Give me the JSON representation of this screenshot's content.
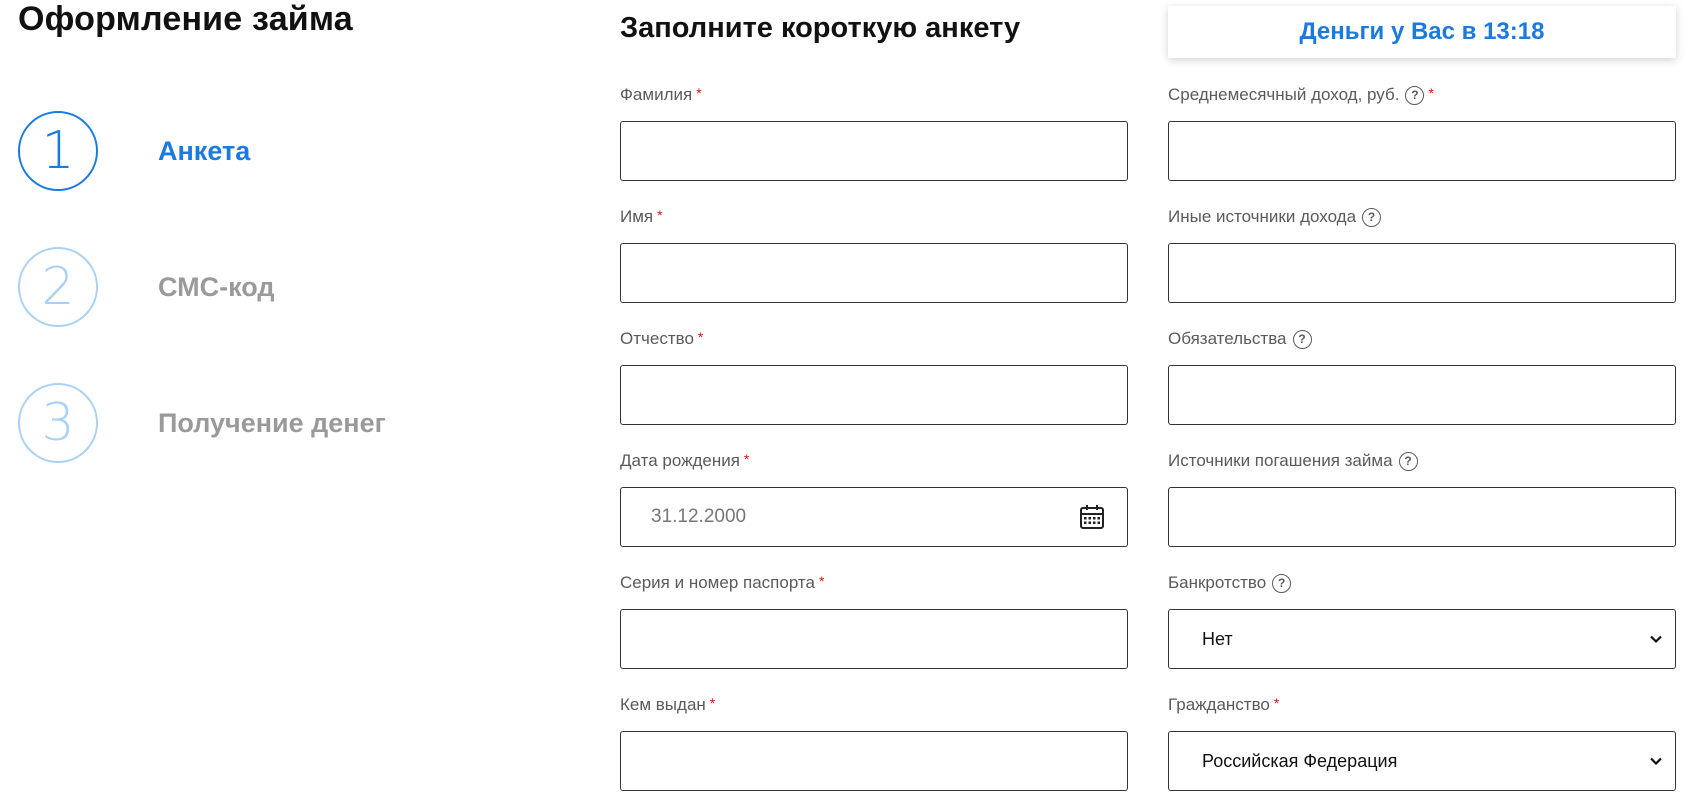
{
  "page": {
    "title": "Оформление займа"
  },
  "steps": [
    {
      "number": "1",
      "label": "Анкета",
      "active": true
    },
    {
      "number": "2",
      "label": "СМС-код",
      "active": false
    },
    {
      "number": "3",
      "label": "Получение денег",
      "active": false
    }
  ],
  "form": {
    "title": "Заполните короткую анкету",
    "money_badge": "Деньги у Вас в 13:18",
    "left": {
      "surname": {
        "label": "Фамилия",
        "value": ""
      },
      "name": {
        "label": "Имя",
        "value": ""
      },
      "patronymic": {
        "label": "Отчество",
        "value": ""
      },
      "birthdate": {
        "label": "Дата рождения",
        "placeholder": "31.12.2000"
      },
      "passport": {
        "label": "Серия и номер паспорта",
        "value": ""
      },
      "issued_by": {
        "label": "Кем выдан",
        "value": ""
      }
    },
    "right": {
      "income": {
        "label": "Среднемесячный доход, руб.",
        "value": ""
      },
      "other_income": {
        "label": "Иные источники дохода",
        "value": ""
      },
      "obligations": {
        "label": "Обязательства",
        "value": ""
      },
      "repayment": {
        "label": "Источники погашения займа",
        "value": ""
      },
      "bankruptcy": {
        "label": "Банкротство",
        "selected": "Нет"
      },
      "citizenship": {
        "label": "Гражданство",
        "selected": "Российская Федерация"
      }
    },
    "required_mark": "*",
    "help_mark": "?"
  },
  "colors": {
    "accent": "#1a7ae0",
    "inactive_circle": "#a9d1f5",
    "inactive_text": "#9a9a9a",
    "required": "#dd1111"
  }
}
